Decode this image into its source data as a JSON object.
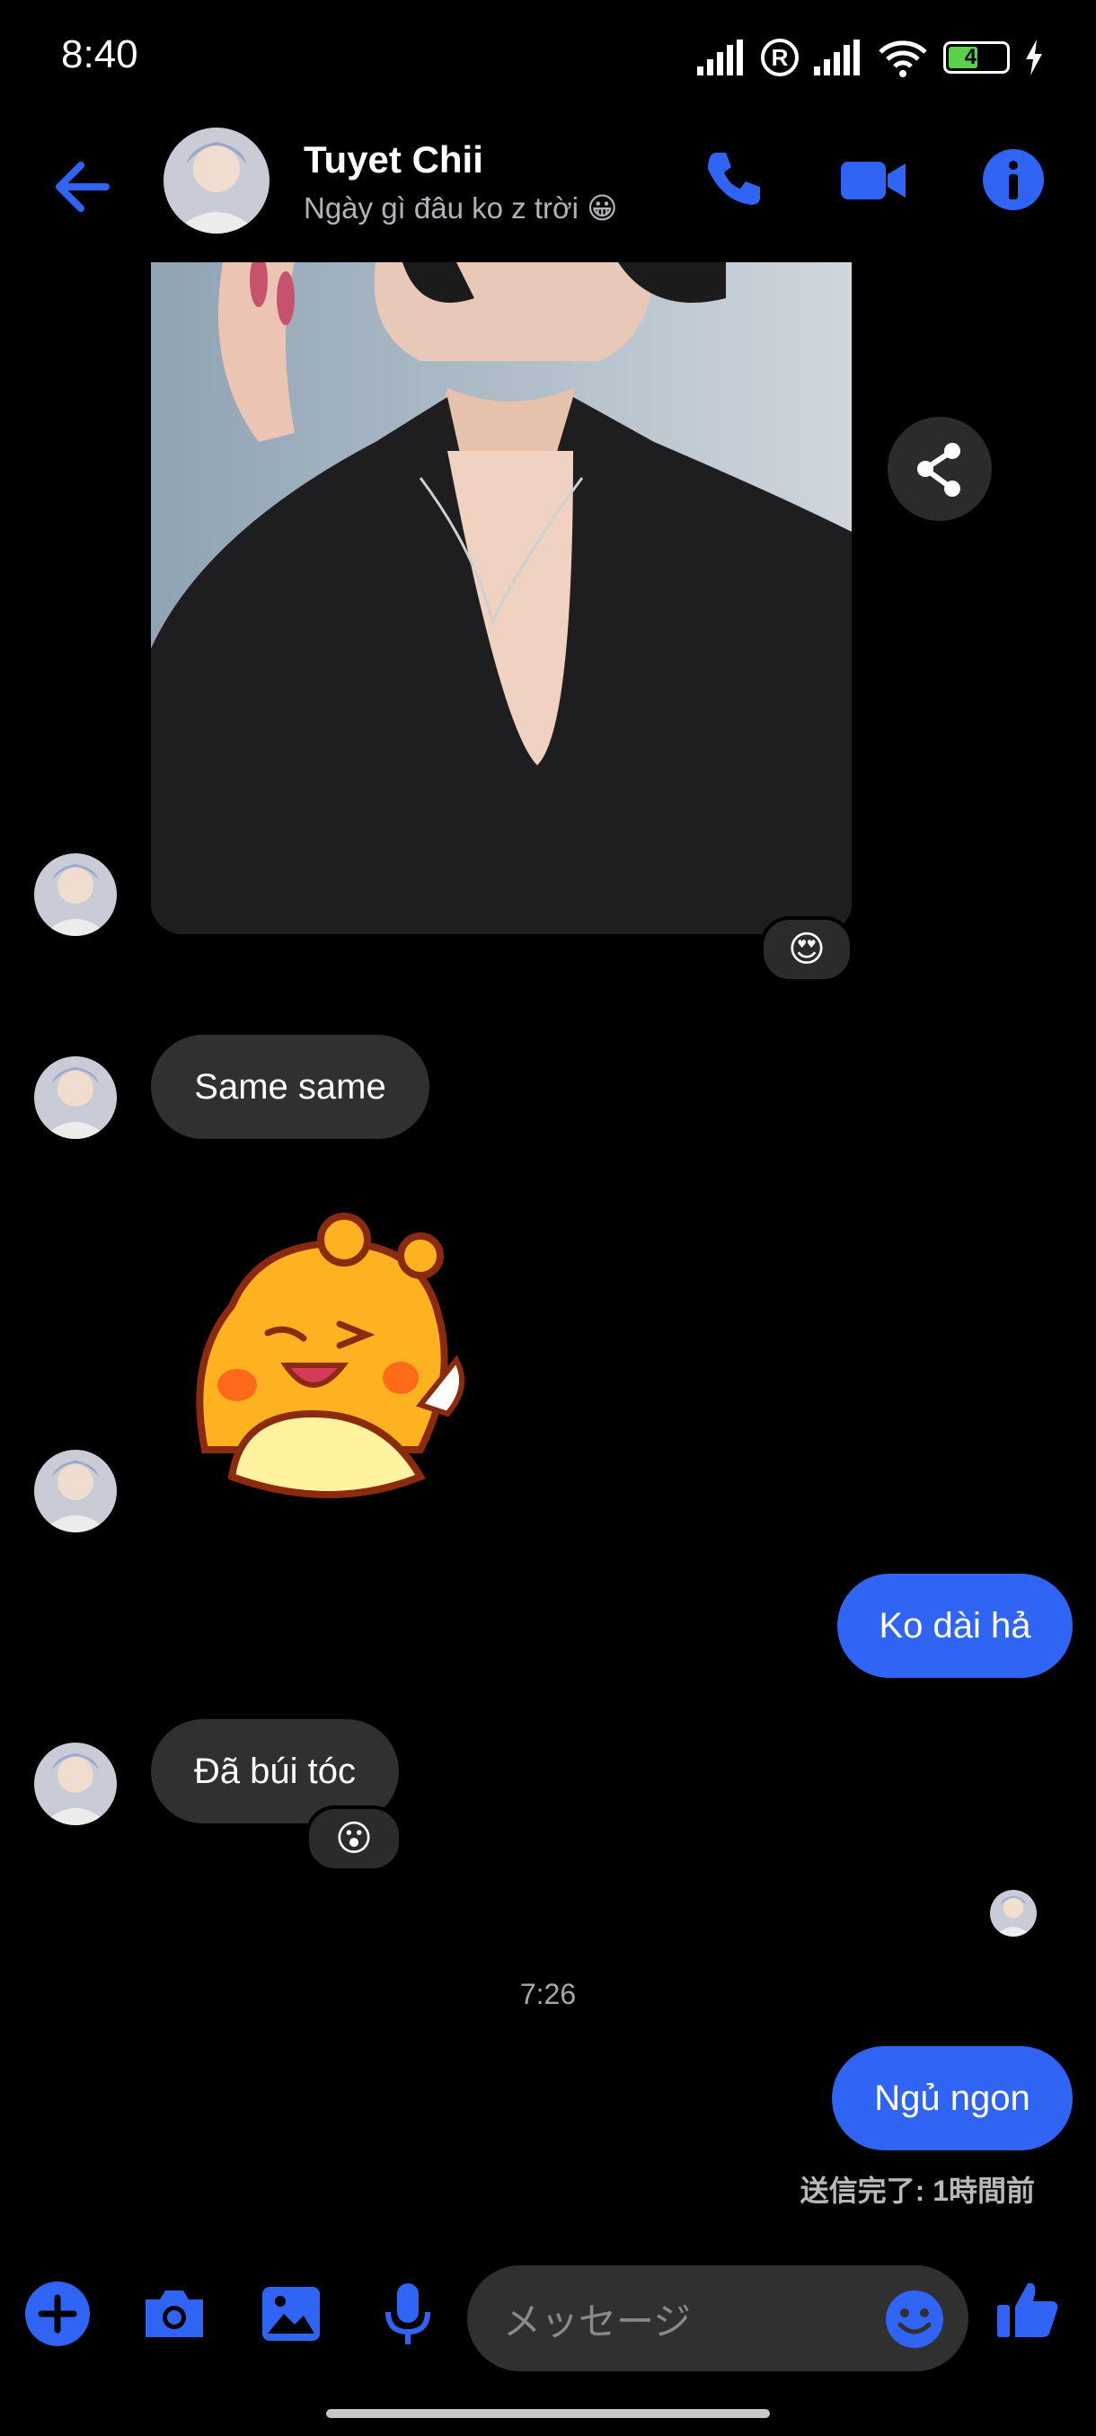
{
  "status_bar": {
    "time": "8:40",
    "battery": "46",
    "icons": [
      "signal-icon",
      "registered-icon",
      "signal-icon",
      "wifi-icon",
      "battery-icon",
      "charging-icon"
    ]
  },
  "header": {
    "name": "Tuyet Chii",
    "status": "Ngày gì đâu ko z trời 😀",
    "icons": [
      "back-arrow-icon",
      "phone-icon",
      "video-icon",
      "info-icon"
    ],
    "accent": "#3064f5"
  },
  "messages": {
    "photo_reaction": "😍",
    "m1": "Same same",
    "m2": "Ko dài hả",
    "m3": "Đã búi tóc",
    "m3_reaction": "😮",
    "timestamp": "7:26",
    "m4": "Ngủ ngon",
    "seen": "送信完了: 1時間前"
  },
  "composer": {
    "placeholder": "メッセージ",
    "icons": [
      "plus-icon",
      "camera-icon",
      "gallery-icon",
      "microphone-icon",
      "emoji-icon",
      "like-icon"
    ]
  }
}
